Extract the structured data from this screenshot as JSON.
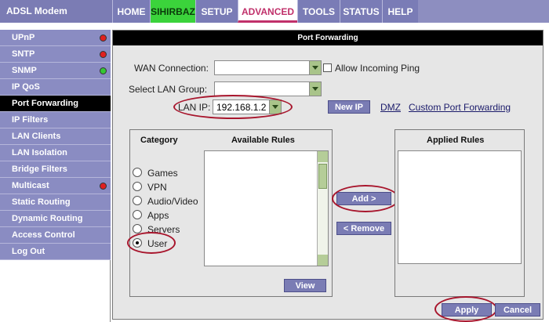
{
  "brand": "ADSL Modem",
  "tabs": [
    {
      "label": "HOME"
    },
    {
      "label": "SIHIRBAZ"
    },
    {
      "label": "SETUP"
    },
    {
      "label": "ADVANCED"
    },
    {
      "label": "TOOLS"
    },
    {
      "label": "STATUS"
    },
    {
      "label": "HELP"
    }
  ],
  "sidebar": {
    "items": [
      {
        "label": "UPnP",
        "status": "red"
      },
      {
        "label": "SNTP",
        "status": "red"
      },
      {
        "label": "SNMP",
        "status": "green"
      },
      {
        "label": "IP QoS"
      },
      {
        "label": "Port Forwarding",
        "active": true
      },
      {
        "label": "IP Filters"
      },
      {
        "label": "LAN Clients"
      },
      {
        "label": "LAN Isolation"
      },
      {
        "label": "Bridge Filters"
      },
      {
        "label": "Multicast",
        "status": "red"
      },
      {
        "label": "Static Routing"
      },
      {
        "label": "Dynamic Routing"
      },
      {
        "label": "Access Control"
      },
      {
        "label": "Log Out"
      }
    ]
  },
  "main": {
    "title": "Port Forwarding",
    "wan_connection_label": "WAN Connection:",
    "wan_connection_value": "",
    "allow_ping_label": "Allow Incoming Ping",
    "lan_group_label": "Select LAN Group:",
    "lan_group_value": "",
    "lan_ip_label": "LAN IP:",
    "lan_ip_value": "192.168.1.2",
    "new_ip_button": "New IP",
    "dmz_link": "DMZ",
    "custom_link": "Custom Port Forwarding",
    "category_title": "Category",
    "available_title": "Available Rules",
    "applied_title": "Applied Rules",
    "categories": [
      {
        "label": "Games",
        "selected": false
      },
      {
        "label": "VPN",
        "selected": false
      },
      {
        "label": "Audio/Video",
        "selected": false
      },
      {
        "label": "Apps",
        "selected": false
      },
      {
        "label": "Servers",
        "selected": false
      },
      {
        "label": "User",
        "selected": true
      }
    ],
    "add_button": "Add >",
    "remove_button": "< Remove",
    "view_button": "View",
    "apply_button": "Apply",
    "cancel_button": "Cancel"
  },
  "colors": {
    "nav": "#8a8cc2",
    "green_tab": "#3bd33b",
    "annotation": "#a8162d"
  }
}
